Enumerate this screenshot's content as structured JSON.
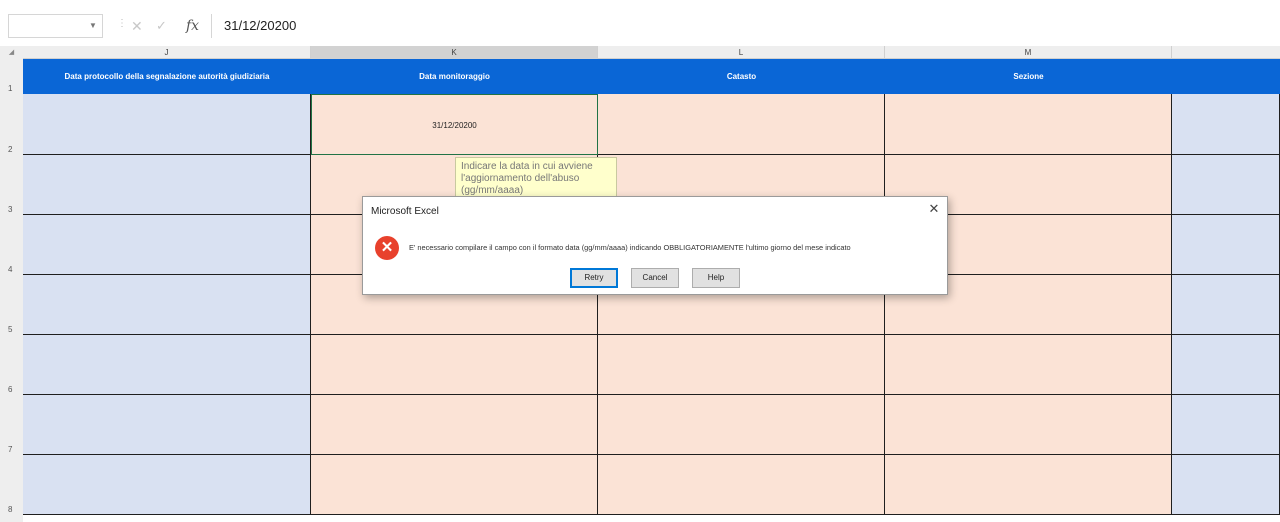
{
  "formula_bar": {
    "fx_label": "fx",
    "value": "31/12/20200"
  },
  "columns": [
    {
      "letter": "J",
      "header": "Data protocollo della segnalazione autorità giudiziaria"
    },
    {
      "letter": "K",
      "header": "Data monitoraggio"
    },
    {
      "letter": "L",
      "header": "Catasto"
    },
    {
      "letter": "M",
      "header": "Sezione"
    }
  ],
  "rows": [
    "1",
    "2",
    "3",
    "4",
    "5",
    "6",
    "7",
    "8"
  ],
  "selected_cell_value": "31/12/20200",
  "comment": "Indicare la data in cui avviene l'aggiornamento dell'abuso (gg/mm/aaaa)",
  "dialog": {
    "title": "Microsoft Excel",
    "message": "E' necessario compilare il campo con il formato data (gg/mm/aaaa) indicando OBBLIGATORIAMENTE l'ultimo giorno del mese indicato",
    "buttons": {
      "retry": "Retry",
      "cancel": "Cancel",
      "help": "Help"
    }
  },
  "colors": {
    "header_blue": "#0a66d6",
    "cell_blue": "#d9e1f2",
    "cell_peach": "#fbe3d6",
    "error_red": "#e8412c"
  }
}
